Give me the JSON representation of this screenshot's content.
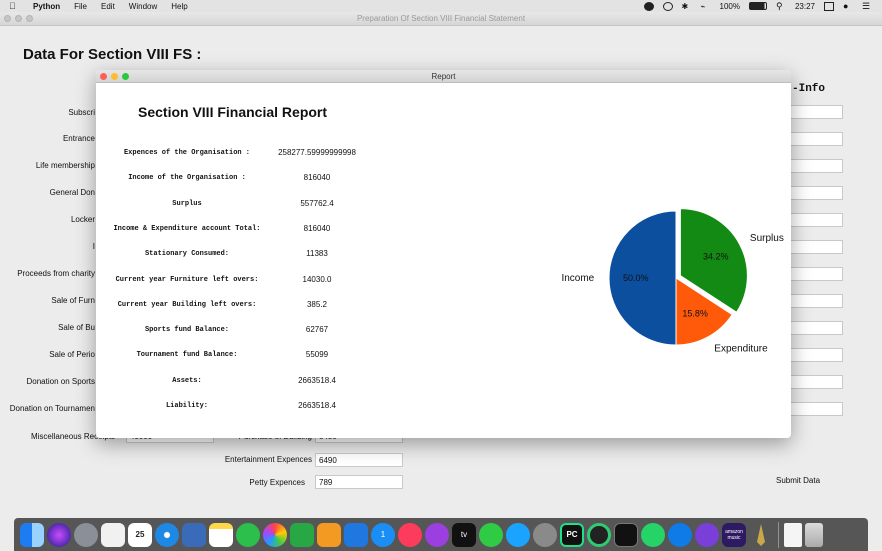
{
  "menubar": {
    "app": "Python",
    "items": [
      "File",
      "Edit",
      "Window",
      "Help"
    ],
    "battery": "100%",
    "clock": "23:27"
  },
  "main_window": {
    "title": "Preparation Of Section VIII Financial Statement",
    "heading": "Data For Section VIII FS  :",
    "info_heading": "-Info",
    "left_labels": [
      "Subscri",
      "Entrance",
      "Life membership",
      "General Don",
      "Locker",
      "I",
      "Proceeds from charity",
      "Sale of Furn",
      "Sale of Bu",
      "Sale of Perio",
      "Donation on Sports",
      "Donation on Tournamen",
      "Miscellaneous Receipts"
    ],
    "misc_value": "45000",
    "purchase_label": "Purchase of Building",
    "purchase_value": "8450",
    "entertainment_label": "Entertainment Expences",
    "entertainment_value": "6490",
    "petty_label": "Petty Expences",
    "petty_value": "789",
    "submit_label": "Submit Data"
  },
  "report": {
    "window_title": "Report",
    "heading": "Section VIII Financial Report",
    "rows": [
      {
        "label": "Expences of the Organisation :",
        "value": "258277.59999999998"
      },
      {
        "label": "Income of the Organisation :",
        "value": "816040"
      },
      {
        "label": "Surplus",
        "value": "557762.4"
      },
      {
        "label": "Income & Expenditure account Total:",
        "value": "816040"
      },
      {
        "label": "Stationary Consumed:",
        "value": "11383"
      },
      {
        "label": "Current year Furniture left overs:",
        "value": "14030.0"
      },
      {
        "label": "Current year Building left overs:",
        "value": "385.2"
      },
      {
        "label": "Sports fund Balance:",
        "value": "62767"
      },
      {
        "label": "Tournament fund Balance:",
        "value": "55099"
      },
      {
        "label": "Assets:",
        "value": "2663518.4"
      },
      {
        "label": "Liability:",
        "value": "2663518.4"
      }
    ]
  },
  "chart_data": {
    "type": "pie",
    "slices": [
      {
        "label": "Income",
        "pct_label": "50.0%",
        "value": 50.0,
        "color": "#0b4f9e"
      },
      {
        "label": "Surplus",
        "pct_label": "34.2%",
        "value": 34.2,
        "color": "#138a13"
      },
      {
        "label": "Expenditure",
        "pct_label": "15.8%",
        "value": 15.8,
        "color": "#ff5a0a"
      }
    ]
  },
  "dock": {
    "calendar_day": "25",
    "appstore_badge": "1",
    "atv_label": "tv",
    "amazon_label": "amazon music",
    "pc_label": "PC"
  }
}
